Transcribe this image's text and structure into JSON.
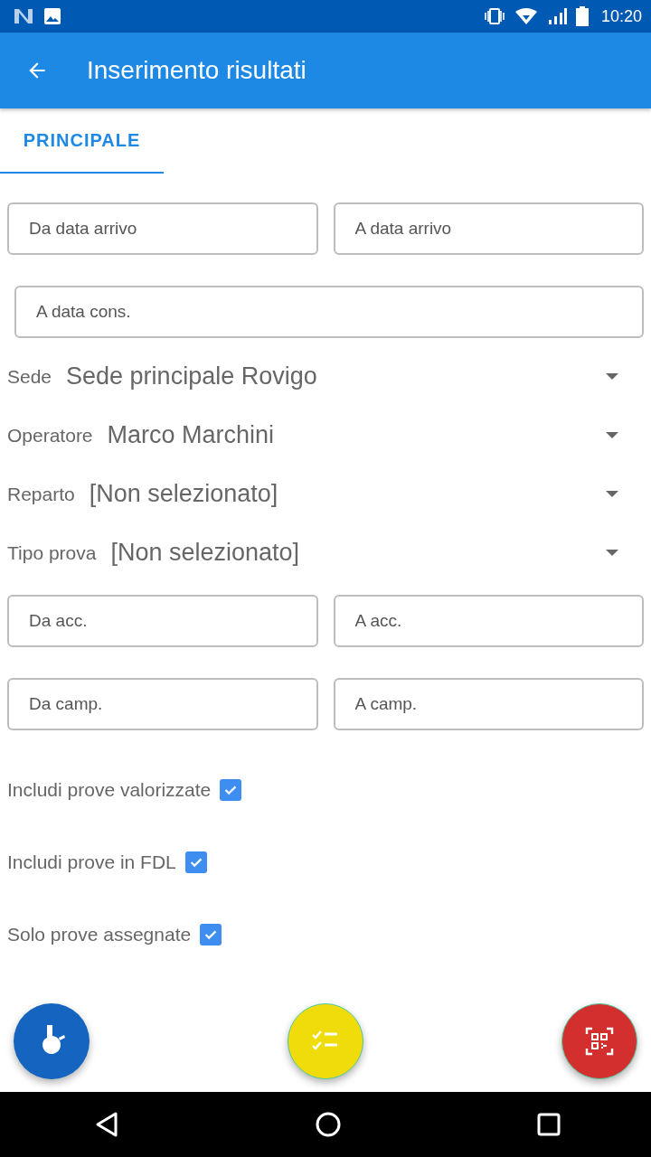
{
  "status_bar": {
    "time": "10:20"
  },
  "app_bar": {
    "title": "Inserimento risultati"
  },
  "tabs": [
    {
      "label": "PRINCIPALE",
      "selected": true
    }
  ],
  "date_fields": [
    [
      {
        "placeholder": "Da data arrivo"
      },
      {
        "placeholder": "A data arrivo"
      }
    ],
    [
      {
        "placeholder": "A data cons."
      }
    ]
  ],
  "dropdowns": [
    {
      "label": "Sede",
      "value": "Sede principale Rovigo"
    },
    {
      "label": "Operatore",
      "value": "Marco Marchini"
    },
    {
      "label": "Reparto",
      "value": "[Non selezionato]"
    },
    {
      "label": "Tipo prova",
      "value": "[Non selezionato]"
    }
  ],
  "range_fields": [
    [
      {
        "placeholder": "Da acc."
      },
      {
        "placeholder": "A acc."
      }
    ],
    [
      {
        "placeholder": "Da camp."
      },
      {
        "placeholder": "A camp."
      }
    ]
  ],
  "checkboxes": [
    {
      "label": "Includi prove valorizzate",
      "checked": true
    },
    {
      "label": "Includi prove in FDL",
      "checked": true
    },
    {
      "label": "Solo prove assegnate",
      "checked": true
    }
  ]
}
